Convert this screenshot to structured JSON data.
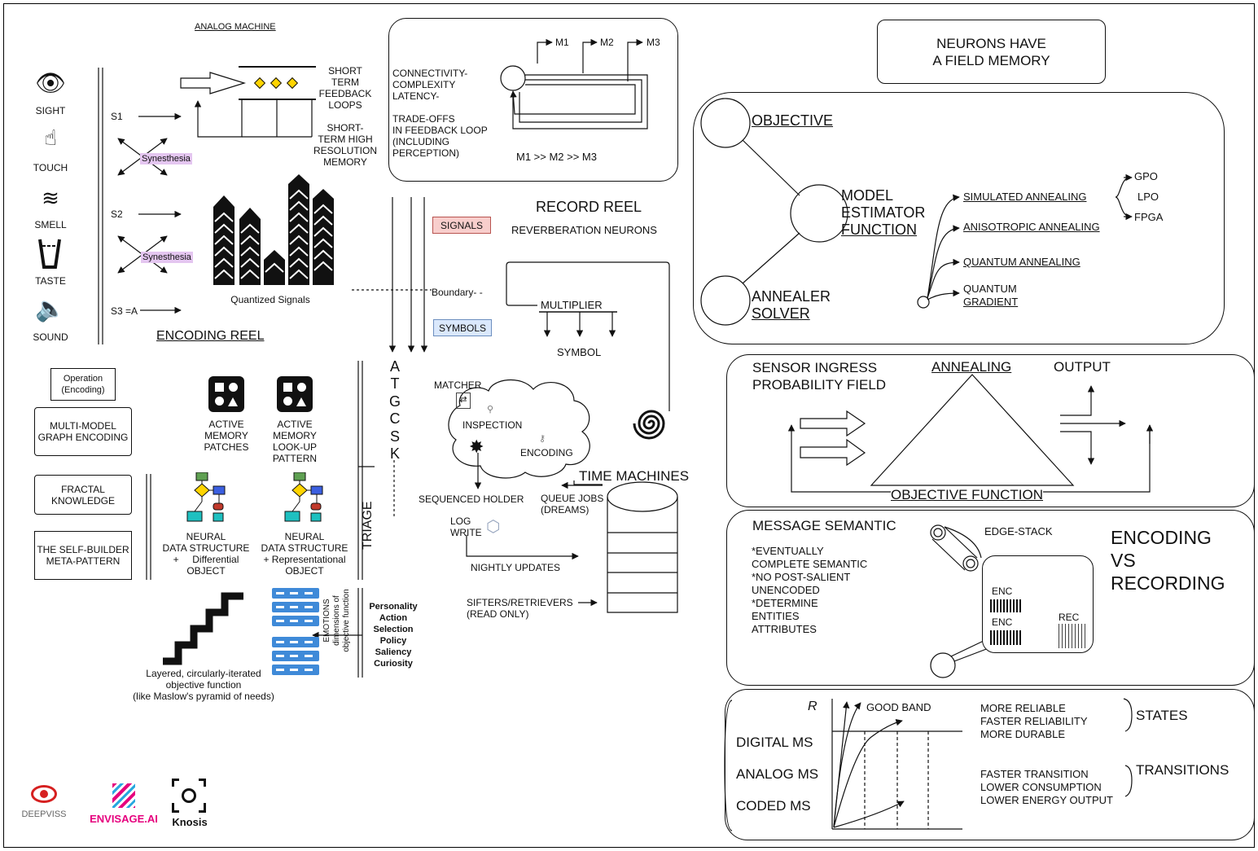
{
  "frame": {
    "border_color": "#000000"
  },
  "analog_machine": {
    "title": "ANALOG MACHINE"
  },
  "senses": [
    {
      "label": "SIGHT",
      "icon": "eye-icon"
    },
    {
      "label": "TOUCH",
      "icon": "touch-icon"
    },
    {
      "label": "SMELL",
      "icon": "smell-icon"
    },
    {
      "label": "TASTE",
      "icon": "glass-icon"
    },
    {
      "label": "SOUND",
      "icon": "speaker-icon"
    }
  ],
  "signals": {
    "s1": "S1",
    "s2": "S2",
    "s3": "S3 =A",
    "synesthesia": "Synesthesia"
  },
  "short_term": {
    "feedback": "SHORT\nTERM\nFEEDBACK\nLOOPS",
    "memory": "SHORT-\nTERM HIGH\nRESOLUTION\nMEMORY"
  },
  "quantized": "Quantized Signals",
  "encoding_reel": "ENCODING REEL",
  "connectivity": {
    "line1": "CONNECTIVITY-\nCOMPLEXITY\nLATENCY-",
    "line2": "TRADE-OFFS\nIN FEEDBACK LOOP\n(INCLUDING\nPERCEPTION)",
    "m1": "M1",
    "m2": "M2",
    "m3": "M3",
    "order": "M1 >> M2 >> M3"
  },
  "record_reel": {
    "title": "RECORD REEL",
    "sub": "REVERBERATION NEURONS",
    "signals": "SIGNALS",
    "symbols": "SYMBOLS",
    "boundary": "Boundary- -",
    "multiplier": "MULTIPLIER",
    "symbol": "SYMBOL",
    "signals_color": "#f8cecc",
    "symbols_color": "#dae8fc"
  },
  "atgcsk": [
    "A",
    "T",
    "G",
    "C",
    "S",
    "K"
  ],
  "left_boxes": {
    "operation": "Operation\n(Encoding)",
    "multi_model": "MULTI-MODEL\nGRAPH ENCODING",
    "fractal": "FRACTAL\nKNOWLEDGE",
    "self_builder": "THE SELF-BUILDER\nMETA-PATTERN"
  },
  "active_memory": {
    "patches": "ACTIVE\nMEMORY\nPATCHES",
    "lookup": "ACTIVE\nMEMORY\nLOOK-UP\nPATTERN"
  },
  "neural": {
    "differential": "NEURAL\nDATA STRUCTURE\n+     Differential\nOBJECT",
    "representational": "NEURAL\nDATA STRUCTURE\n+ Representational\nOBJECT"
  },
  "triage": "TRIAGE",
  "layered": "Layered, circularly-iterated\nobjective function\n(like Maslow's pyramid of needs)",
  "emotions": "EMOTIONS\ndimensions of\nobjective function",
  "personality": "Personality\nAction\nSelection\nPolicy\nSaliency\nCuriosity",
  "matcher": {
    "matcher": "MATCHER",
    "inspection": "INSPECTION",
    "encoding": "ENCODING",
    "sequenced": "SEQUENCED HOLDER",
    "queue": "QUEUE JOBS\n(DREAMS)",
    "log": "LOG\nWRITE",
    "nightly": "NIGHTLY UPDATES",
    "sifters": "SIFTERS/RETRIEVERS\n(READ ONLY)",
    "time_machines": "TIME MACHINES"
  },
  "neurons_field": "NEURONS HAVE\nA FIELD MEMORY",
  "objective_panel": {
    "objective": "OBJECTIVE",
    "model": "MODEL\nESTIMATOR",
    "function": "FUNCTION",
    "annealer": "ANNEALER",
    "solver": "SOLVER",
    "simulated": "SIMULATED ANNEALING",
    "anisotropic": "ANISOTROPIC ANNEALING",
    "quantum": "QUANTUM ANNEALING",
    "quantum_gradient_1": "QUANTUM",
    "quantum_gradient_2": "GRADIENT",
    "gpo": "GPO",
    "lpo": "LPO",
    "fpga": "FPGA"
  },
  "annealing_panel": {
    "sensor": "SENSOR INGRESS\nPROBABILITY FIELD",
    "annealing": "ANNEALING",
    "output": "OUTPUT",
    "objective_function": "OBJECTIVE FUNCTION"
  },
  "message_panel": {
    "title": "MESSAGE SEMANTIC",
    "items": "*EVENTUALLY\nCOMPLETE SEMANTIC\n*NO POST-SALIENT\nUNENCODED\n*DETERMINE\nENTITIES\nATTRIBUTES",
    "edge_stack": "EDGE-STACK",
    "enc1": "ENC",
    "enc2": "ENC",
    "rec": "REC",
    "encoding_vs": "ENCODING\nVS\nRECORDING"
  },
  "ms_panel": {
    "r": "R",
    "good_band": "GOOD BAND",
    "digital": "DIGITAL MS",
    "analog": "ANALOG MS",
    "coded": "CODED MS",
    "states_list": "MORE RELIABLE\nFASTER RELIABILITY\nMORE DURABLE",
    "states": "STATES",
    "transitions_list": "FASTER TRANSITION\nLOWER CONSUMPTION\nLOWER ENERGY OUTPUT",
    "transitions": "TRANSITIONS"
  },
  "brands": {
    "deepviss": "DEEPVISS",
    "envisage": "ENVISAGE.AI",
    "knosis": "Knosis",
    "envisage_color": "#e6007e",
    "deepviss_color": "#d62020"
  }
}
